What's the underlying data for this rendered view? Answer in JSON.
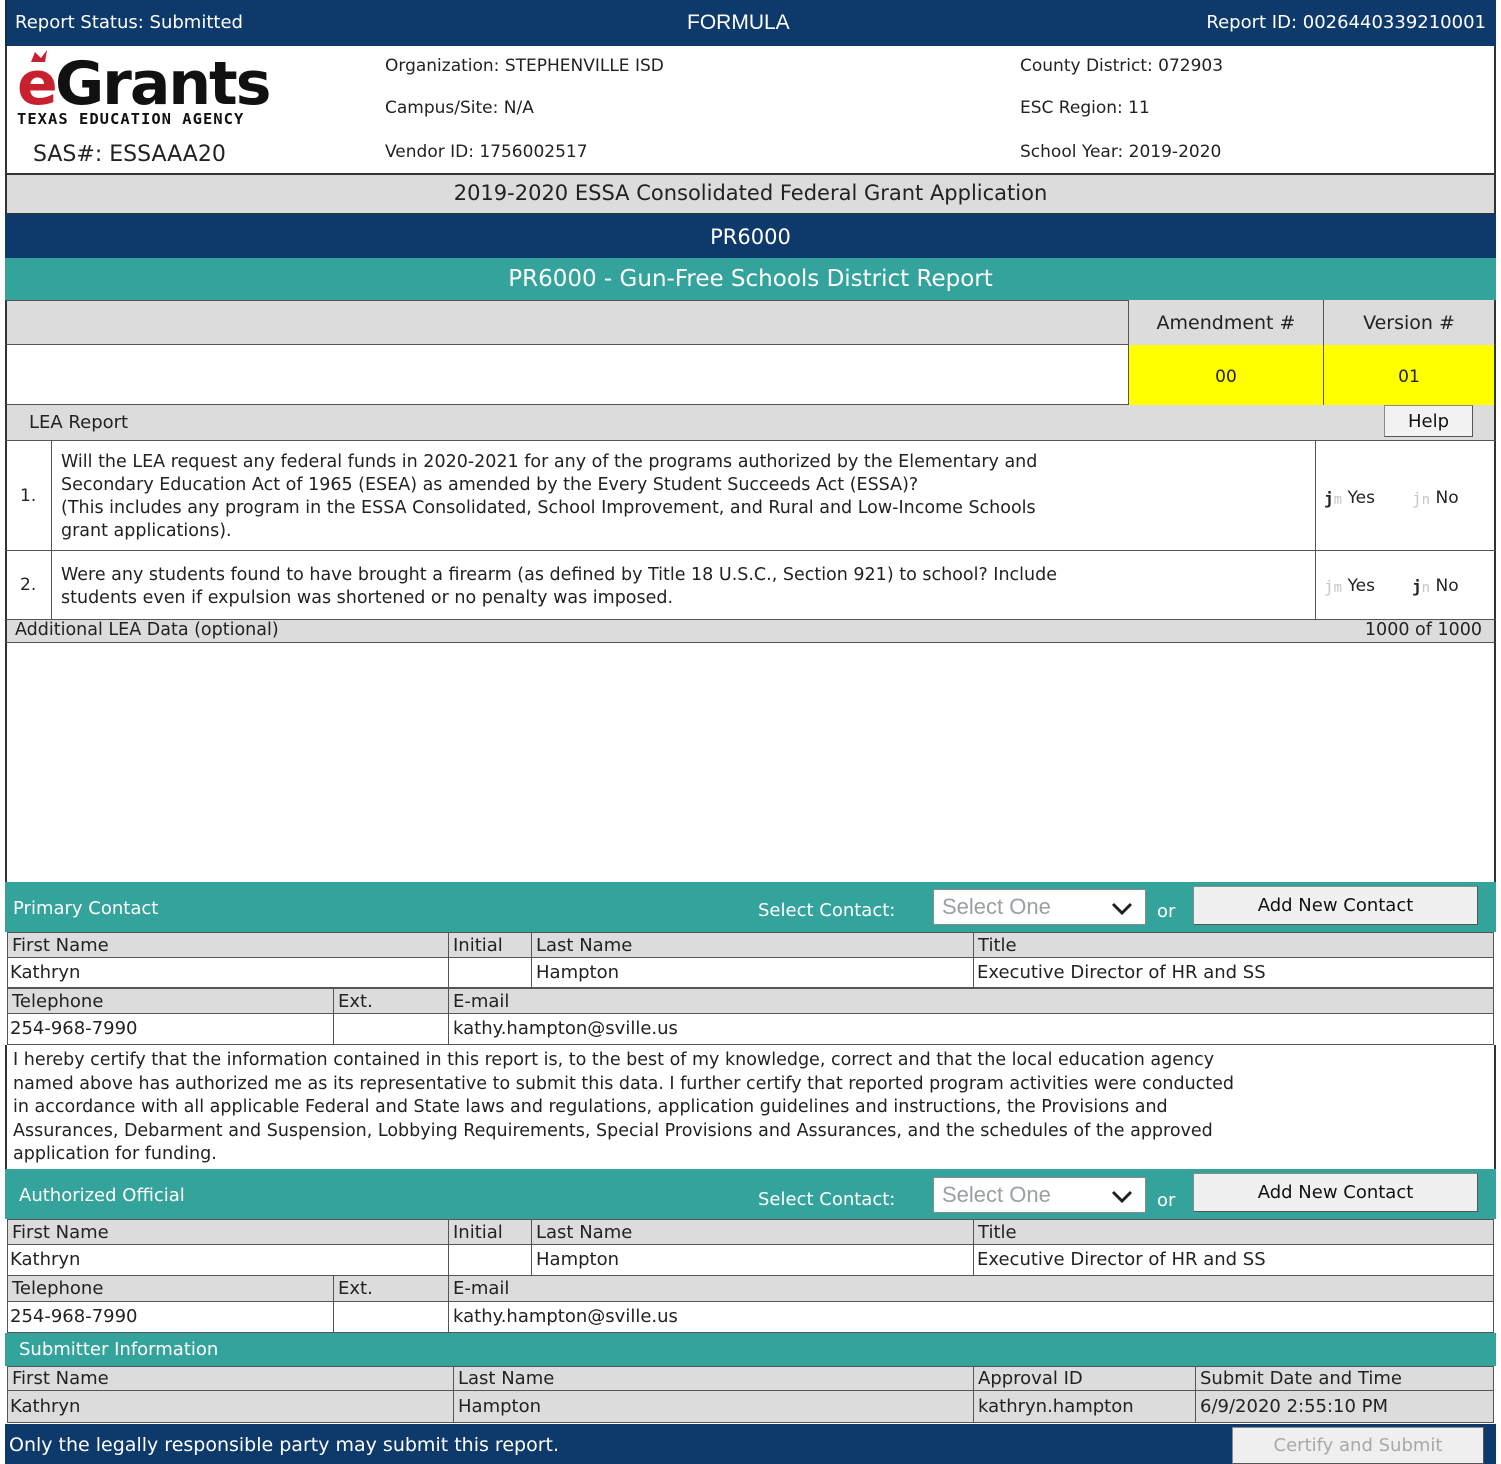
{
  "header": {
    "report_status": "Report Status: Submitted",
    "formula": "FORMULA",
    "report_id": "Report ID: 0026440339210001"
  },
  "logo": {
    "brand": "eGrants",
    "agency": "TEXAS EDUCATION AGENCY",
    "sas": "SAS#: ESSAAA20"
  },
  "org_info": {
    "organization": "Organization: STEPHENVILLE ISD",
    "campus": "Campus/Site: N/A",
    "vendor": "Vendor ID: 1756002517",
    "county_district": "County District: 072903",
    "esc_region": "ESC Region: 11",
    "school_year": "School Year: 2019-2020"
  },
  "titles": {
    "application": "2019-2020 ESSA Consolidated Federal Grant Application",
    "schedule_code": "PR6000",
    "schedule_title": "PR6000 - Gun-Free Schools District Report"
  },
  "amendment": {
    "amendment_label": "Amendment #",
    "version_label": "Version #",
    "amendment_value": "00",
    "version_value": "01"
  },
  "lea_report": {
    "label": "LEA Report",
    "help_button": "Help",
    "questions": [
      {
        "num": "1.",
        "line1": "Will the LEA request any federal funds in 2020-2021 for any of the programs authorized by the Elementary and",
        "line2": "Secondary Education Act of 1965 (ESEA) as amended by the Every Student Succeeds Act (ESSA)?",
        "line3": "(This includes any program in the ESSA Consolidated, School Improvement, and Rural and Low-Income Schools",
        "line4": "grant applications).",
        "yes_glyph": "j",
        "yes_mark": "m",
        "yes_label": "Yes",
        "no_glyph": "j",
        "no_mark": "n",
        "no_label": "No",
        "selected": "Yes"
      },
      {
        "num": "2.",
        "line1": "Were any students found to have brought a firearm (as defined by Title 18 U.S.C., Section 921) to school? Include",
        "line2": "students even if expulsion was shortened or no penalty was imposed.",
        "yes_glyph": "j",
        "yes_mark": "m",
        "yes_label": "Yes",
        "no_glyph": "j",
        "no_mark": "n",
        "no_label": "No",
        "selected": "No"
      }
    ]
  },
  "additional_data": {
    "label": "Additional LEA Data (optional)",
    "counter": "1000 of 1000",
    "value": ""
  },
  "primary_contact": {
    "section_label": "Primary Contact",
    "select_label": "Select Contact:",
    "select_placeholder": "Select One",
    "or": "or",
    "add_button": "Add New Contact",
    "headers": {
      "first_name": "First Name",
      "initial": "Initial",
      "last_name": "Last Name",
      "title": "Title",
      "telephone": "Telephone",
      "ext": "Ext.",
      "email": "E-mail"
    },
    "first_name": "Kathryn",
    "initial": "",
    "last_name": "Hampton",
    "title": "Executive Director of HR and SS",
    "telephone": "254-968-7990",
    "ext": "",
    "email": "kathy.hampton@sville.us"
  },
  "certification": {
    "line1": "I hereby certify that the information contained in this report is, to the best of my knowledge, correct and that the local education agency",
    "line2": "named above has authorized me as its representative to submit this data. I further certify that reported program activities were conducted",
    "line3": "in accordance with all applicable Federal and State laws and regulations, application guidelines and instructions, the Provisions and",
    "line4": "Assurances, Debarment and Suspension, Lobbying Requirements, Special Provisions and Assurances, and the schedules of the approved",
    "line5": "application for funding."
  },
  "authorized_official": {
    "section_label": "Authorized Official",
    "select_label": "Select Contact:",
    "select_placeholder": "Select One",
    "or": "or",
    "add_button": "Add New Contact",
    "headers": {
      "first_name": "First Name",
      "initial": "Initial",
      "last_name": "Last Name",
      "title": "Title",
      "telephone": "Telephone",
      "ext": "Ext.",
      "email": "E-mail"
    },
    "first_name": "Kathryn",
    "initial": "",
    "last_name": "Hampton",
    "title": "Executive Director of HR and SS",
    "telephone": "254-968-7990",
    "ext": "",
    "email": "kathy.hampton@sville.us"
  },
  "submitter": {
    "section_label": "Submitter Information",
    "headers": {
      "first_name": "First Name",
      "last_name": "Last Name",
      "approval_id": "Approval ID",
      "submit_datetime": "Submit Date and Time"
    },
    "first_name": "Kathryn",
    "last_name": "Hampton",
    "approval_id": "kathryn.hampton",
    "submit_datetime": "6/9/2020 2:55:10 PM"
  },
  "footer": {
    "notice": "Only the legally responsible party may submit this report.",
    "submit_button": "Certify and Submit"
  },
  "colors": {
    "navy": "#0e3a6b",
    "teal": "#34a39c",
    "highlight_yellow": "#ffff00",
    "header_gray": "#dcdcdc",
    "logo_red": "#c8202f"
  }
}
